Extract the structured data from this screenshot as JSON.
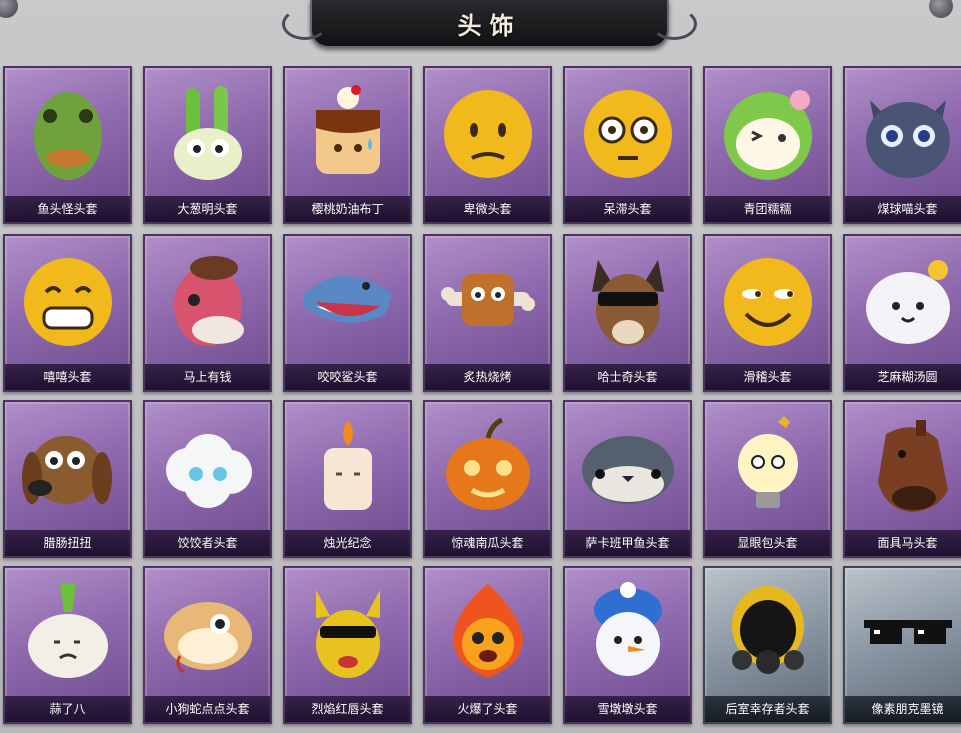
{
  "header": {
    "title": "头饰"
  },
  "items": [
    {
      "label": "鱼头怪头套",
      "icon": "fish-mask-icon"
    },
    {
      "label": "大葱明头套",
      "icon": "green-onion-icon"
    },
    {
      "label": "樱桃奶油布丁",
      "icon": "pudding-icon"
    },
    {
      "label": "卑微头套",
      "icon": "humble-emoji-icon"
    },
    {
      "label": "呆滞头套",
      "icon": "blank-stare-emoji-icon"
    },
    {
      "label": "青团糯糯",
      "icon": "green-rice-ball-icon"
    },
    {
      "label": "煤球喵头套",
      "icon": "black-cat-icon"
    },
    {
      "label": "嘻嘻头套",
      "icon": "grin-emoji-icon"
    },
    {
      "label": "马上有钱",
      "icon": "pink-horse-icon"
    },
    {
      "label": "咬咬鲨头套",
      "icon": "shark-icon"
    },
    {
      "label": "炙热烧烤",
      "icon": "roast-meat-icon"
    },
    {
      "label": "哈士奇头套",
      "icon": "husky-sunglasses-icon"
    },
    {
      "label": "滑稽头套",
      "icon": "smirk-emoji-icon"
    },
    {
      "label": "芝麻糊汤圆",
      "icon": "dumpling-icon"
    },
    {
      "label": "腊肠扭扭",
      "icon": "dachshund-icon"
    },
    {
      "label": "饺饺者头套",
      "icon": "cloud-dumpling-icon"
    },
    {
      "label": "烛光纪念",
      "icon": "candle-icon"
    },
    {
      "label": "惊魂南瓜头套",
      "icon": "pumpkin-icon"
    },
    {
      "label": "萨卡班甲鱼头套",
      "icon": "sacabambaspis-icon"
    },
    {
      "label": "显眼包头套",
      "icon": "lightbulb-icon"
    },
    {
      "label": "面具马头套",
      "icon": "horse-mask-icon"
    },
    {
      "label": "蒜了八",
      "icon": "garlic-icon"
    },
    {
      "label": "小狗蛇点点头套",
      "icon": "snake-icon"
    },
    {
      "label": "烈焰红唇头套",
      "icon": "yellow-mouse-icon"
    },
    {
      "label": "火爆了头套",
      "icon": "fire-icon"
    },
    {
      "label": "雪墩墩头套",
      "icon": "snowman-icon"
    },
    {
      "label": "后室幸存者头套",
      "icon": "gas-mask-icon"
    },
    {
      "label": "像素朋克墨镜",
      "icon": "pixel-sunglasses-icon"
    }
  ],
  "colors": {
    "card_purple": "#8e69ad",
    "card_gray": "#8793a0",
    "label_bg": "#1e1230"
  }
}
